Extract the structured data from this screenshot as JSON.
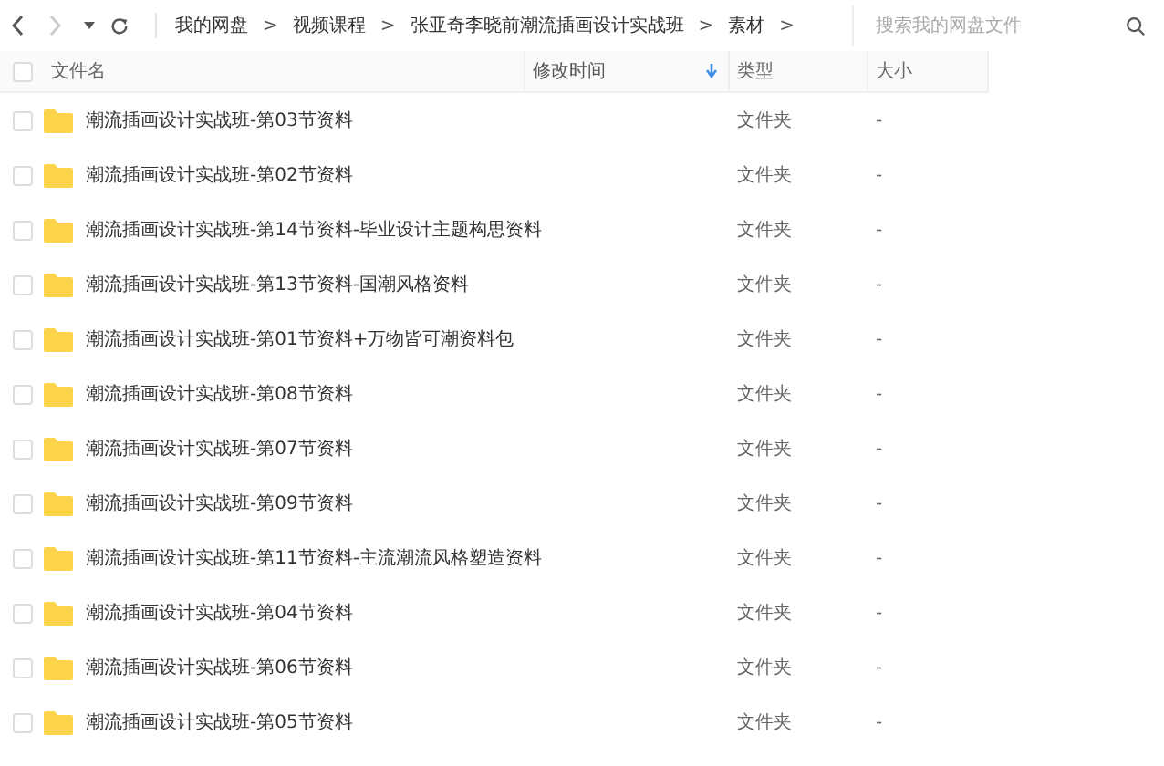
{
  "nav": {
    "back_disabled": false,
    "forward_disabled": true
  },
  "breadcrumb": [
    {
      "label": "我的网盘",
      "sep": ">"
    },
    {
      "label": "视频课程",
      "sep": ">"
    },
    {
      "label": "张亚奇李晓前潮流插画设计实战班",
      "sep": ">"
    },
    {
      "label": "素材",
      "sep": ">"
    }
  ],
  "search": {
    "placeholder": "搜索我的网盘文件"
  },
  "table": {
    "select_all_checked": false,
    "columns": [
      {
        "label": "文件名",
        "sorted": false
      },
      {
        "label": "修改时间",
        "sorted": true
      },
      {
        "label": "类型",
        "sorted": false
      },
      {
        "label": "大小",
        "sorted": false
      }
    ],
    "rows": [
      {
        "name": "潮流插画设计实战班-第03节资料",
        "type": "文件夹",
        "size": "-",
        "checked": false
      },
      {
        "name": "潮流插画设计实战班-第02节资料",
        "type": "文件夹",
        "size": "-",
        "checked": false
      },
      {
        "name": "潮流插画设计实战班-第14节资料-毕业设计主题构思资料",
        "type": "文件夹",
        "size": "-",
        "checked": false
      },
      {
        "name": "潮流插画设计实战班-第13节资料-国潮风格资料",
        "type": "文件夹",
        "size": "-",
        "checked": false
      },
      {
        "name": "潮流插画设计实战班-第01节资料+万物皆可潮资料包",
        "type": "文件夹",
        "size": "-",
        "checked": false
      },
      {
        "name": "潮流插画设计实战班-第08节资料",
        "type": "文件夹",
        "size": "-",
        "checked": false
      },
      {
        "name": "潮流插画设计实战班-第07节资料",
        "type": "文件夹",
        "size": "-",
        "checked": false
      },
      {
        "name": "潮流插画设计实战班-第09节资料",
        "type": "文件夹",
        "size": "-",
        "checked": false
      },
      {
        "name": "潮流插画设计实战班-第11节资料-主流潮流风格塑造资料",
        "type": "文件夹",
        "size": "-",
        "checked": false
      },
      {
        "name": "潮流插画设计实战班-第04节资料",
        "type": "文件夹",
        "size": "-",
        "checked": false
      },
      {
        "name": "潮流插画设计实战班-第06节资料",
        "type": "文件夹",
        "size": "-",
        "checked": false
      },
      {
        "name": "潮流插画设计实战班-第05节资料",
        "type": "文件夹",
        "size": "-",
        "checked": false
      }
    ]
  }
}
